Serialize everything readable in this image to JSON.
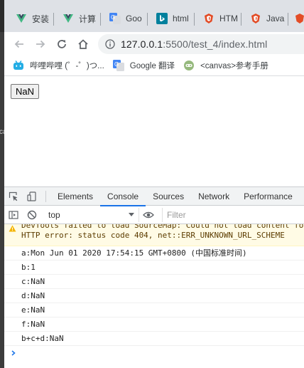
{
  "tabs": [
    {
      "label": "安装",
      "icon": "vue-icon"
    },
    {
      "label": "计算",
      "icon": "vue-icon"
    },
    {
      "label": "Goo",
      "icon": "google-translate-icon"
    },
    {
      "label": "html",
      "icon": "bing-icon"
    },
    {
      "label": "HTM",
      "icon": "html-shield-icon"
    },
    {
      "label": "Java",
      "icon": "html-shield-icon"
    }
  ],
  "address": {
    "host": "127.0.0.1",
    "rest": ":5500/test_4/index.html"
  },
  "bookmarks": [
    {
      "label": "哔哩哔哩 (゜-゜)つ...",
      "icon": "bilibili-icon"
    },
    {
      "label": "Google 翻译",
      "icon": "google-translate-icon"
    },
    {
      "label": "<canvas>参考手册",
      "icon": "runoob-icon"
    }
  ],
  "page": {
    "button_label": "NaN"
  },
  "left_strip_text": "ca",
  "devtools": {
    "tabs": [
      "Elements",
      "Console",
      "Sources",
      "Network",
      "Performance"
    ],
    "active_tab": "Console",
    "context": "top",
    "filter_placeholder": "Filter",
    "warning": {
      "line1": "DevTools failed to load SourceMap: Could not load content for",
      "line2": "HTTP error: status code 404, net::ERR_UNKNOWN_URL_SCHEME"
    },
    "logs": [
      "a:Mon Jun 01 2020 17:54:15 GMT+0800 (中国标准时间)",
      "b:1",
      "c:NaN",
      "d:NaN",
      "e:NaN",
      "f:NaN",
      "b+c+d:NaN"
    ]
  },
  "colors": {
    "vue": "#41b883",
    "google": "#4285f4",
    "bing": "#00809d",
    "html": "#e34c26",
    "link": "#1a73e8"
  }
}
